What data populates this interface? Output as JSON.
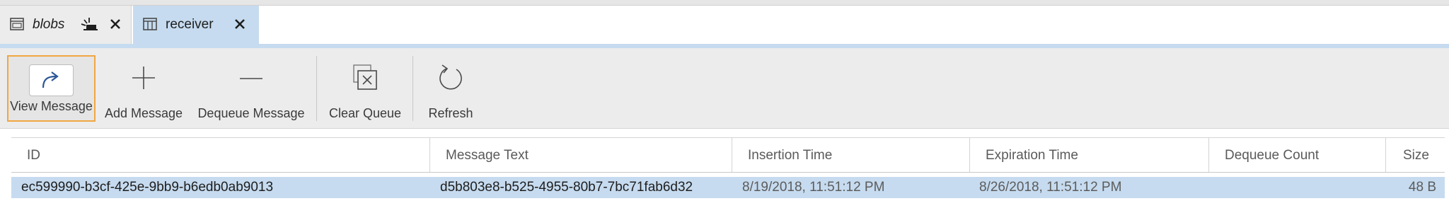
{
  "tabs": [
    {
      "label": "blobs",
      "icon": "window-icon"
    },
    {
      "label": "receiver",
      "icon": "table-icon"
    }
  ],
  "toolbar": {
    "view_message": "View Message",
    "add_message": "Add Message",
    "dequeue_message": "Dequeue Message",
    "clear_queue": "Clear Queue",
    "refresh": "Refresh"
  },
  "table": {
    "columns": [
      "ID",
      "Message Text",
      "Insertion Time",
      "Expiration Time",
      "Dequeue Count",
      "Size"
    ],
    "rows": [
      {
        "id": "ec599990-b3cf-425e-9bb9-b6edb0ab9013",
        "message_text": "d5b803e8-b525-4955-80b7-7bc71fab6d32",
        "insertion_time": "8/19/2018, 11:51:12 PM",
        "expiration_time": "8/26/2018, 11:51:12 PM",
        "dequeue_count": "",
        "size": "48 B"
      }
    ]
  },
  "colors": {
    "active_tab": "#c6dbef",
    "selected_row": "#c6dbef",
    "focus_border": "#f0a742",
    "toolbar_bg": "#ececec",
    "icon_accent": "#2b5797"
  }
}
